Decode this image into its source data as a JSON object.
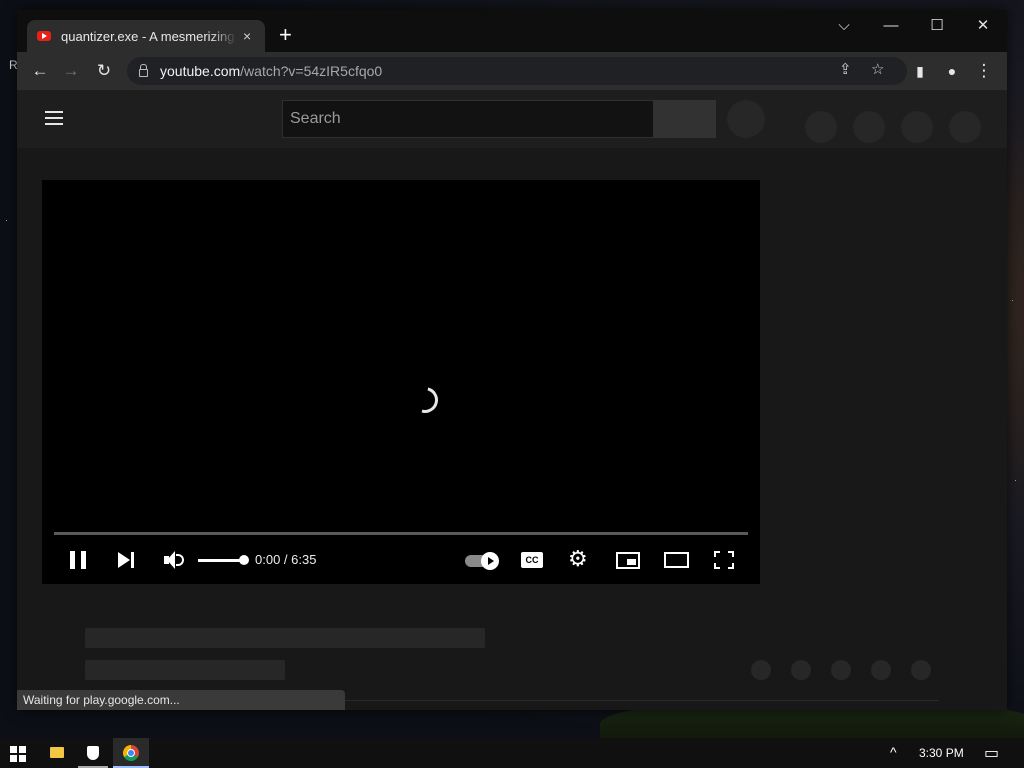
{
  "desktop": {
    "label": "R"
  },
  "browser": {
    "tab": {
      "title": "quantizer.exe - A mesmerizing Tr",
      "close_icon": "×"
    },
    "new_tab_icon": "+",
    "window_controls": {
      "tabsearch": "⌵",
      "minimize": "—",
      "maximize": "☐",
      "close": "✕"
    },
    "toolbar": {
      "back_icon": "←",
      "forward_icon": "→",
      "reload_icon": "↻",
      "url_host": "youtube.com",
      "url_path": "/watch?v=54zIR5cfqo0",
      "share_icon": "⇪",
      "bookmark_icon": "☆",
      "sidepanel_icon": "▮",
      "profile_icon": "●",
      "menu_icon": "⋮"
    }
  },
  "youtube": {
    "search": {
      "placeholder": "Search"
    },
    "player": {
      "time": "0:00 / 6:35",
      "cc_label": "CC",
      "settings_icon": "⚙"
    },
    "status_text": "Waiting for play.google.com..."
  },
  "taskbar": {
    "clock": "3:30 PM",
    "tray_chevron": "^",
    "notifications_icon": "▭"
  }
}
